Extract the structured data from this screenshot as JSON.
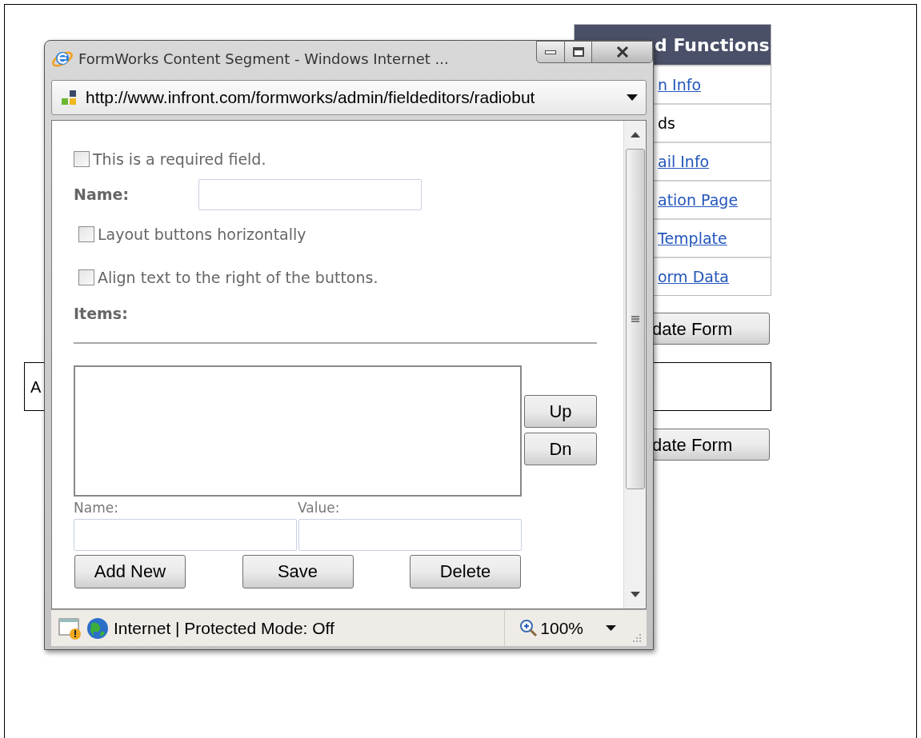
{
  "background": {
    "panel_title": "d Functions",
    "panel_items": [
      {
        "label": "n Info",
        "kind": "link"
      },
      {
        "label": "ds",
        "kind": "text"
      },
      {
        "label": "ail Info",
        "kind": "link"
      },
      {
        "label": "ation Page",
        "kind": "link"
      },
      {
        "label": "Template",
        "kind": "link"
      },
      {
        "label": "orm Data",
        "kind": "link"
      }
    ],
    "update_button": "date Form",
    "box_text": "A",
    "update_button_2": "date Form"
  },
  "popup": {
    "title": "FormWorks Content Segment - Windows Internet ...",
    "address": "http://www.infront.com/formworks/admin/fieldeditors/radiobut",
    "required": {
      "label": "This is a required field.",
      "checked": false
    },
    "name_label": "Name:",
    "options": [
      {
        "label": "Layout buttons horizontally",
        "checked": false
      },
      {
        "label": "Align text to the right of the buttons.",
        "checked": false
      }
    ],
    "items_label": "Items:",
    "up_button": "Up",
    "down_button": "Dn",
    "item_name_label": "Name:",
    "item_value_label": "Value:",
    "buttons": [
      "Add New",
      "Save",
      "Delete"
    ],
    "status_text": "Internet | Protected Mode: Off",
    "zoom": "100%"
  }
}
